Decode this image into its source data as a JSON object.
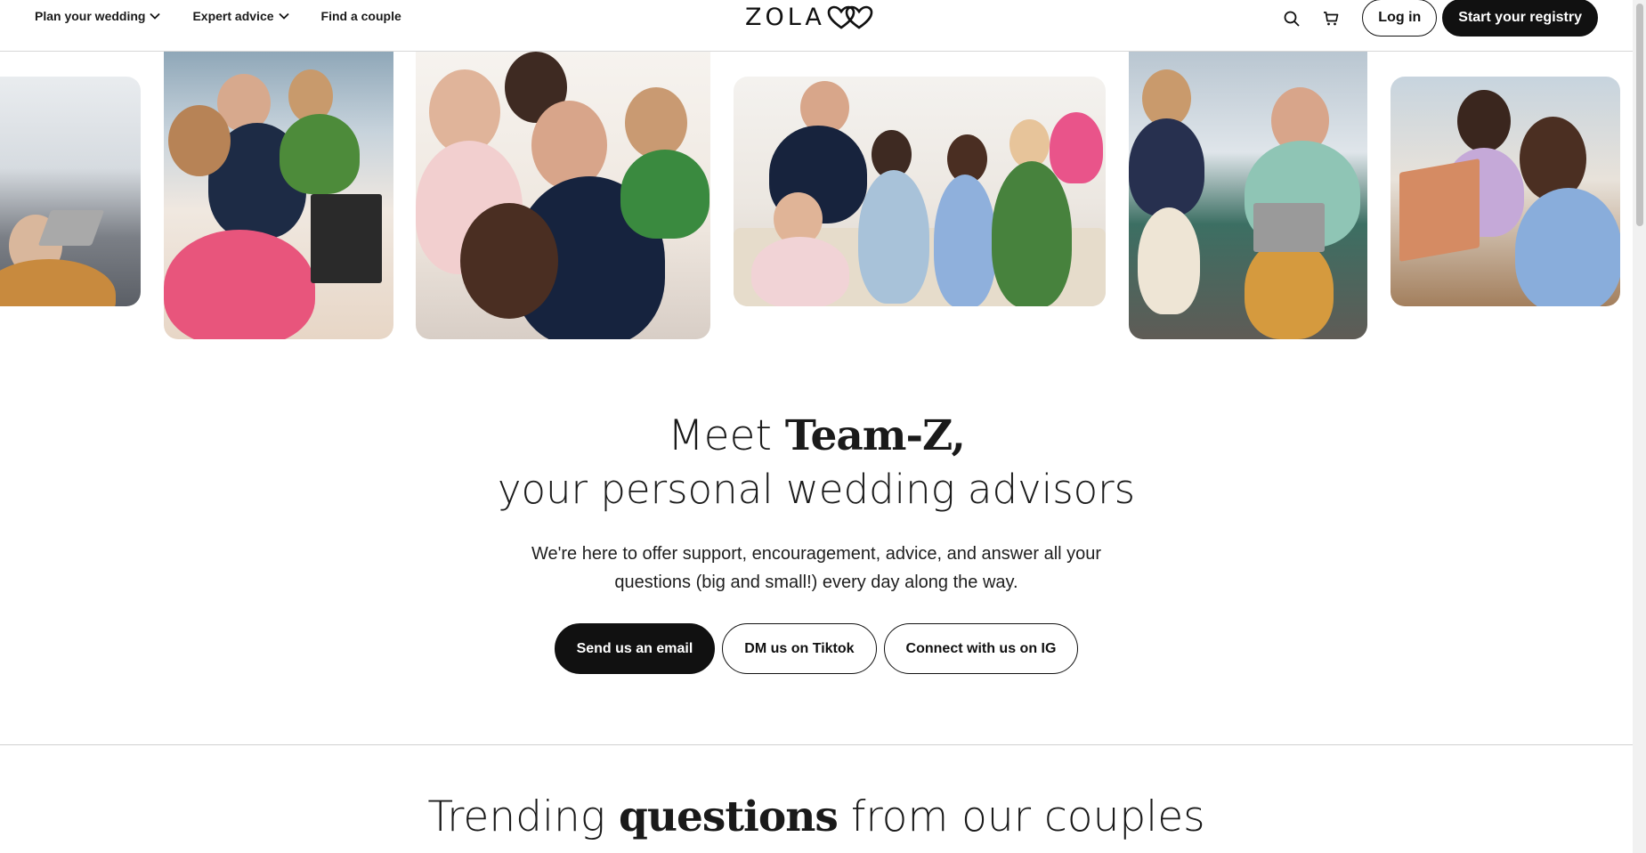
{
  "header": {
    "nav": [
      {
        "label": "Plan your wedding",
        "has_dropdown": true
      },
      {
        "label": "Expert advice",
        "has_dropdown": true
      },
      {
        "label": "Find a couple",
        "has_dropdown": false
      }
    ],
    "logo_text": "ZOLA",
    "login_label": "Log in",
    "registry_label": "Start your registry"
  },
  "hero": {
    "title_prefix": "Meet ",
    "title_bold": "Team-Z,",
    "title_line2": "your personal wedding advisors",
    "subtitle": "We're here to offer support, encouragement, advice, and answer all your questions (big and small!) every day along the way.",
    "buttons": [
      {
        "label": "Send us an email",
        "style": "solid"
      },
      {
        "label": "DM us on Tiktok",
        "style": "outline"
      },
      {
        "label": "Connect with us on IG",
        "style": "outline"
      }
    ]
  },
  "trending": {
    "prefix": "Trending ",
    "bold": "questions",
    "suffix": " from our couples"
  },
  "icons": {
    "search": "search-icon",
    "cart": "cart-icon",
    "chevron": "chevron-down-icon",
    "logo_hearts": "hearts-icon"
  },
  "colors": {
    "primary": "#111111",
    "background": "#ffffff",
    "divider": "#d0d0d0"
  }
}
